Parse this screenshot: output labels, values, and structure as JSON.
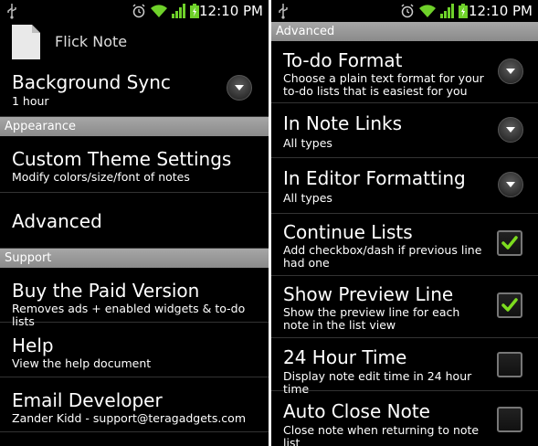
{
  "left": {
    "status_time": "12:10 PM",
    "app_title": "Flick Note",
    "items": [
      {
        "title": "Background Sync",
        "summary": "1 hour"
      },
      {
        "section": "Appearance"
      },
      {
        "title": "Custom Theme Settings",
        "summary": "Modify colors/size/font of notes"
      },
      {
        "title": "Advanced"
      },
      {
        "section": "Support"
      },
      {
        "title": "Buy the Paid Version",
        "summary": "Removes ads + enabled widgets & to-do lists"
      },
      {
        "title": "Help",
        "summary": "View the help document"
      },
      {
        "title": "Email Developer",
        "summary": "Zander Kidd - support@teragadgets.com"
      }
    ]
  },
  "right": {
    "status_time": "12:10 PM",
    "section_title": "Advanced",
    "items": [
      {
        "title": "To-do Format",
        "summary": "Choose a plain text format for your to-do lists that is easiest for you",
        "control": "dropdown"
      },
      {
        "title": "In Note Links",
        "summary": "All types",
        "control": "dropdown"
      },
      {
        "title": "In Editor Formatting",
        "summary": "All types",
        "control": "dropdown"
      },
      {
        "title": "Continue Lists",
        "summary": "Add checkbox/dash if previous line had one",
        "control": "checkbox",
        "checked": true
      },
      {
        "title": "Show Preview Line",
        "summary": "Show the preview line for each note in the list view",
        "control": "checkbox",
        "checked": true
      },
      {
        "title": "24 Hour Time",
        "summary": "Display note edit time in 24 hour time",
        "control": "checkbox",
        "checked": false
      },
      {
        "title": "Auto Close Note",
        "summary": "Close note when returning to note list",
        "control": "checkbox",
        "checked": false
      }
    ]
  },
  "colors": {
    "check": "#7ddc1f",
    "section_bg": "#9a9a9a",
    "battery": "#6fd12a"
  },
  "icons": [
    "usb-icon",
    "alarm-icon",
    "wifi-icon",
    "signal-icon",
    "battery-icon",
    "document-icon",
    "dropdown-arrow-icon",
    "checkmark-icon"
  ]
}
